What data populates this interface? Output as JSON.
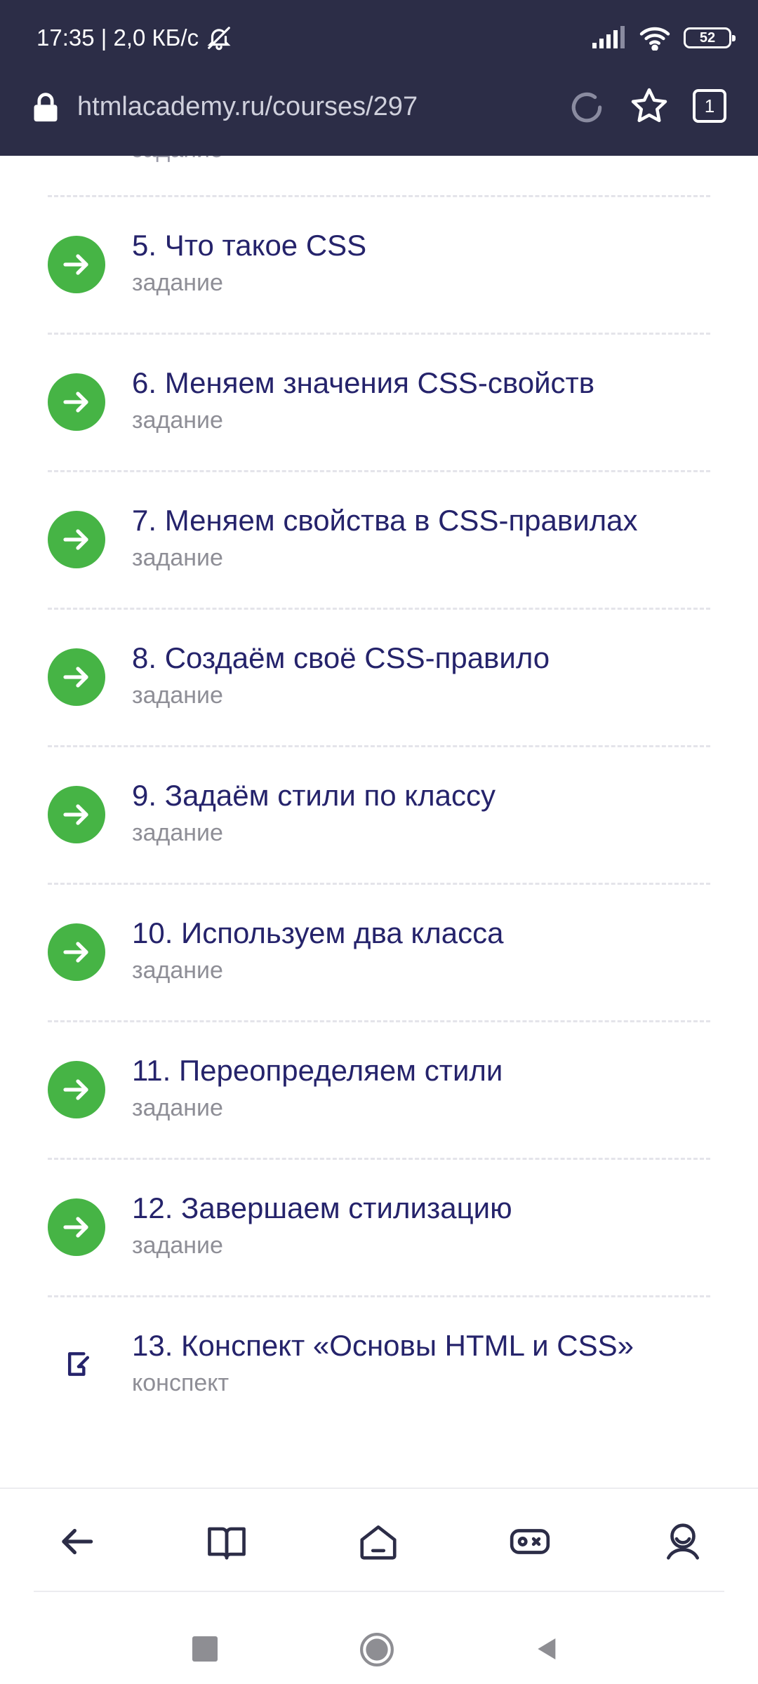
{
  "status_bar": {
    "time_speed": "17:35 | 2,0 КБ/с",
    "battery": "52"
  },
  "browser": {
    "url": "htmlacademy.ru/courses/297",
    "tab_count": "1"
  },
  "partial_top_text": "задание",
  "lessons": [
    {
      "title": "5. Что такое CSS",
      "type": "задание"
    },
    {
      "title": "6. Меняем значения CSS-свойств",
      "type": "задание"
    },
    {
      "title": "7. Меняем свойства в CSS-правилах",
      "type": "задание"
    },
    {
      "title": "8. Создаём своё CSS-правило",
      "type": "задание"
    },
    {
      "title": "9. Задаём стили по классу",
      "type": "задание"
    },
    {
      "title": "10. Используем два класса",
      "type": "задание"
    },
    {
      "title": "11. Переопределяем стили",
      "type": "задание"
    },
    {
      "title": "12. Завершаем стилизацию",
      "type": "задание"
    },
    {
      "title": "13. Конспект «Основы HTML и CSS»",
      "type": "конспект"
    }
  ],
  "colors": {
    "topbar": "#2c2d47",
    "accent_green": "#46b445",
    "title": "#25236b",
    "subtitle": "#8e8e96"
  },
  "icons": {
    "lesson_task": "arrow-right-icon",
    "lesson_notes": "notes-icon",
    "nav": [
      "back-arrow-icon",
      "book-icon",
      "home-icon",
      "gamepad-icon",
      "profile-icon"
    ]
  }
}
